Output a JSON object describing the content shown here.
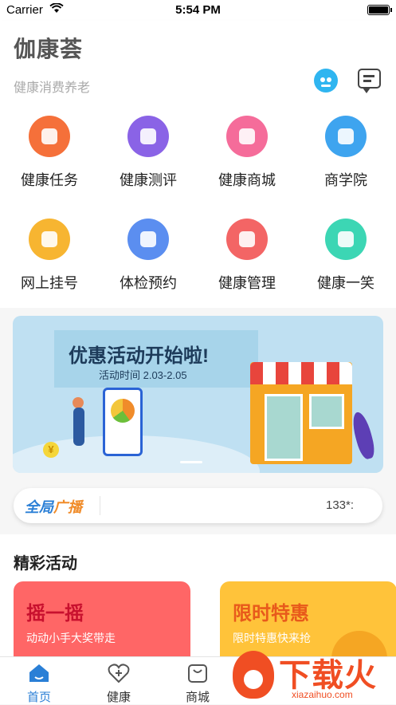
{
  "status_bar": {
    "carrier": "Carrier",
    "wifi_icon": "wifi-icon",
    "time": "5:54 PM",
    "battery_icon": "battery-icon"
  },
  "header": {
    "title": "伽康荟",
    "subtitle": "健康消费养老",
    "robot_icon": "robot-assistant-icon",
    "message_icon": "message-icon"
  },
  "grid": [
    {
      "label": "健康任务",
      "icon": "task-icon",
      "color": "#f5703a"
    },
    {
      "label": "健康测评",
      "icon": "assessment-icon",
      "color": "#8a63e6"
    },
    {
      "label": "健康商城",
      "icon": "shopping-bag-icon",
      "color": "#f56c9a"
    },
    {
      "label": "商学院",
      "icon": "school-icon",
      "color": "#3ea4ef"
    },
    {
      "label": "网上挂号",
      "icon": "calendar-icon",
      "color": "#f7b531"
    },
    {
      "label": "体检预约",
      "icon": "checkup-icon",
      "color": "#5b8ef0"
    },
    {
      "label": "健康管理",
      "icon": "layers-icon",
      "color": "#f36565"
    },
    {
      "label": "健康一笑",
      "icon": "smile-icon",
      "color": "#3cd6b4"
    }
  ],
  "banner": {
    "title": "优惠活动开始啦!",
    "date": "活动时间 2.03-2.05",
    "coin_text": "¥"
  },
  "broadcast": {
    "logo_main": "全局",
    "logo_accent": "广播",
    "text": "133*:"
  },
  "section": {
    "title": "精彩活动",
    "cards": [
      {
        "title": "摇一摇",
        "subtitle": "动动小手大奖带走"
      },
      {
        "title": "限时特惠",
        "subtitle": "限时特惠快来抢"
      }
    ]
  },
  "tabbar": [
    {
      "label": "首页",
      "icon": "home-icon",
      "active": true
    },
    {
      "label": "健康",
      "icon": "health-icon",
      "active": false
    },
    {
      "label": "商城",
      "icon": "shop-icon",
      "active": false
    }
  ],
  "watermark": {
    "text": "下载火",
    "url": "xiazaihuo.com"
  },
  "colors": {
    "accent": "#2a7fd6",
    "card_red": "#ff6666",
    "card_yellow": "#ffc33a",
    "watermark": "#f04e23"
  }
}
